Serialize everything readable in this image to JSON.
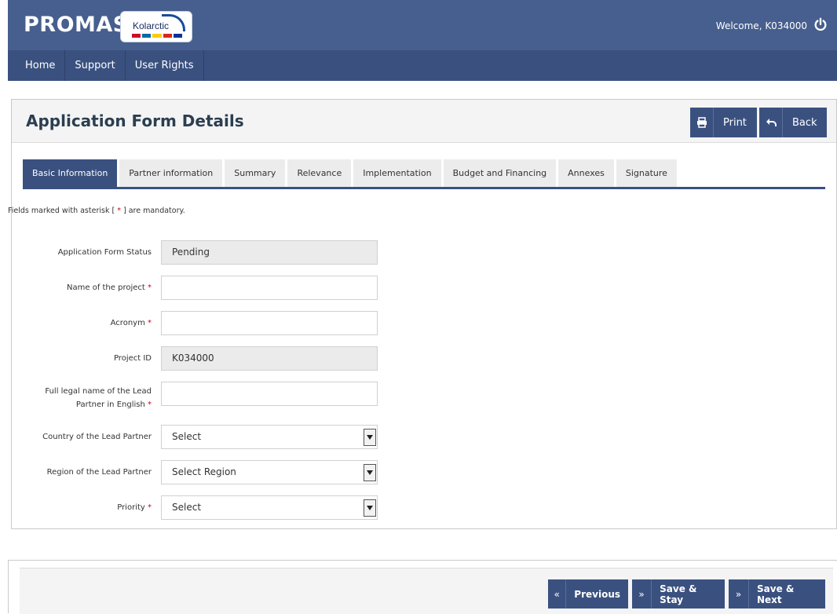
{
  "header": {
    "brand": "PROMAS",
    "logo_text": "Kolarctic",
    "welcome": "Welcome, K034000"
  },
  "nav": {
    "items": [
      {
        "label": "Home"
      },
      {
        "label": "Support"
      },
      {
        "label": "User Rights"
      }
    ]
  },
  "page": {
    "title": "Application Form Details",
    "print_label": "Print",
    "back_label": "Back"
  },
  "tabs": [
    {
      "label": "Basic Information",
      "active": true
    },
    {
      "label": "Partner information",
      "active": false
    },
    {
      "label": "Summary",
      "active": false
    },
    {
      "label": "Relevance",
      "active": false
    },
    {
      "label": "Implementation",
      "active": false
    },
    {
      "label": "Budget and Financing",
      "active": false
    },
    {
      "label": "Annexes",
      "active": false
    },
    {
      "label": "Signature",
      "active": false
    }
  ],
  "form": {
    "note_prefix": "Fields marked with asterisk [",
    "note_star": " * ",
    "note_suffix": "] are mandatory.",
    "status": {
      "label": "Application Form Status",
      "value": "Pending"
    },
    "project_name": {
      "label": "Name of the project",
      "value": ""
    },
    "acronym": {
      "label": "Acronym",
      "value": ""
    },
    "project_id": {
      "label": "Project ID",
      "value": "K034000"
    },
    "lead_partner_name": {
      "label_line1": "Full legal name of the Lead",
      "label_line2": "Partner in English",
      "value": ""
    },
    "country": {
      "label": "Country of the Lead Partner",
      "value": "Select"
    },
    "region": {
      "label": "Region of the Lead Partner",
      "value": "Select Region"
    },
    "priority": {
      "label": "Priority",
      "value": "Select"
    },
    "required_mark": "*"
  },
  "footer": {
    "previous_label": "Previous",
    "save_stay_label": "Save & Stay",
    "save_next_label": "Save & Next",
    "prev_icon": "«",
    "next_icon": "»"
  },
  "colors": {
    "topbar": "#465f8e",
    "navbar": "#3a5180",
    "accent": "#3a5180",
    "required": "#d0021b"
  }
}
